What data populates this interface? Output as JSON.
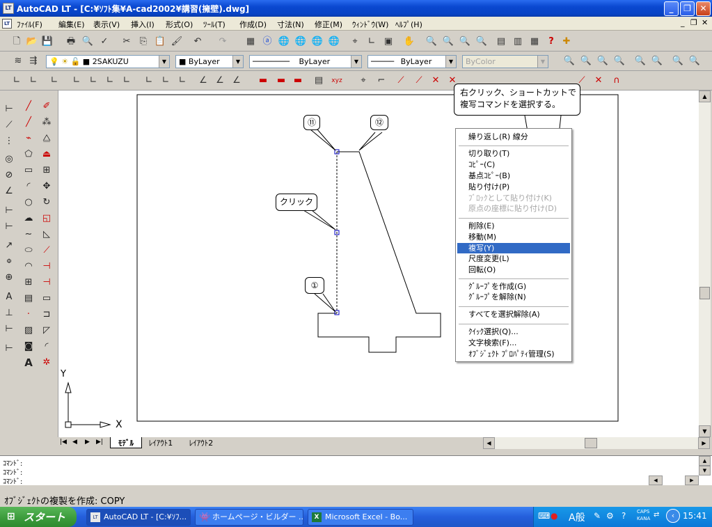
{
  "window": {
    "app_icon": "LT",
    "title": "AutoCAD LT - [C:¥ｿﾌﾄ集¥A-cad2002¥講習(擁壁).dwg]",
    "min": "_",
    "max": "❐",
    "close": "✕"
  },
  "menu": {
    "app_icon": "LT",
    "items": [
      "ﾌｧｲﾙ(F)",
      "編集(E)",
      "表示(V)",
      "挿入(I)",
      "形式(O)",
      "ﾂｰﾙ(T)",
      "作成(D)",
      "寸法(N)",
      "修正(M)",
      "ｳｨﾝﾄﾞｳ(W)",
      "ﾍﾙﾌﾟ(H)"
    ],
    "doc_min": "_",
    "doc_max": "❐",
    "doc_close": "✕"
  },
  "layer_toolbar": {
    "layer": "2SAKUZU",
    "color": "ByLayer",
    "linetype": "ByLayer",
    "lineweight": "ByLayer",
    "plotstyle": "ByColor"
  },
  "drawing": {
    "callouts": {
      "top_left_marker": "⑪",
      "top_right_marker": "⑫",
      "bottom_marker": "①",
      "click_label": "クリック",
      "instruction_line1": "右クリック、ショートカットで",
      "instruction_line2": "複写コマンドを選択する。"
    },
    "ucs_x": "X",
    "ucs_y": "Y"
  },
  "context_menu": {
    "items": [
      {
        "label": "繰り返し(R) 線分",
        "state": "normal"
      },
      {
        "label": "切り取り(T)",
        "state": "normal"
      },
      {
        "label": "ｺﾋﾟｰ(C)",
        "state": "normal"
      },
      {
        "label": "基点ｺﾋﾟｰ(B)",
        "state": "normal"
      },
      {
        "label": "貼り付け(P)",
        "state": "normal"
      },
      {
        "label": "ﾌﾞﾛｯｸとして貼り付け(K)",
        "state": "disabled"
      },
      {
        "label": "原点の座標に貼り付け(D)",
        "state": "disabled"
      },
      {
        "label": "削除(E)",
        "state": "normal"
      },
      {
        "label": "移動(M)",
        "state": "normal"
      },
      {
        "label": "複写(Y)",
        "state": "selected"
      },
      {
        "label": "尺度変更(L)",
        "state": "normal"
      },
      {
        "label": "回転(O)",
        "state": "normal"
      },
      {
        "label": "ｸﾞﾙｰﾌﾟを作成(G)",
        "state": "normal"
      },
      {
        "label": "ｸﾞﾙｰﾌﾟを解除(N)",
        "state": "normal"
      },
      {
        "label": "すべてを選択解除(A)",
        "state": "normal"
      },
      {
        "label": "ｸｲｯｸ選択(Q)...",
        "state": "normal"
      },
      {
        "label": "文字検索(F)...",
        "state": "normal"
      },
      {
        "label": "ｵﾌﾞｼﾞｪｸﾄ ﾌﾟﾛﾊﾟﾃｨ管理(S)",
        "state": "normal"
      }
    ]
  },
  "layout_tabs": [
    "ﾓﾃﾞﾙ",
    "ﾚｲｱｳﾄ1",
    "ﾚｲｱｳﾄ2"
  ],
  "command": {
    "lines": [
      "ｺﾏﾝﾄﾞ:",
      "ｺﾏﾝﾄﾞ:",
      "ｺﾏﾝﾄﾞ:"
    ],
    "status": "ｵﾌﾞｼﾞｪｸﾄの複製を作成:  COPY"
  },
  "taskbar": {
    "start": "スタート",
    "tasks": [
      {
        "label": "AutoCAD LT - [C:¥ｿﾌ...",
        "active": true
      },
      {
        "label": "ホームページ・ビルダー ...",
        "active": false
      },
      {
        "label": "Microsoft Excel - Bo...",
        "active": false
      }
    ],
    "ime": "A般",
    "caps": "CAPS",
    "kana": "KANA",
    "time": "15:41"
  },
  "colors": {
    "title_blue": "#0a48d0",
    "selection_blue": "#316ac5",
    "start_green": "#3a9a3a"
  }
}
